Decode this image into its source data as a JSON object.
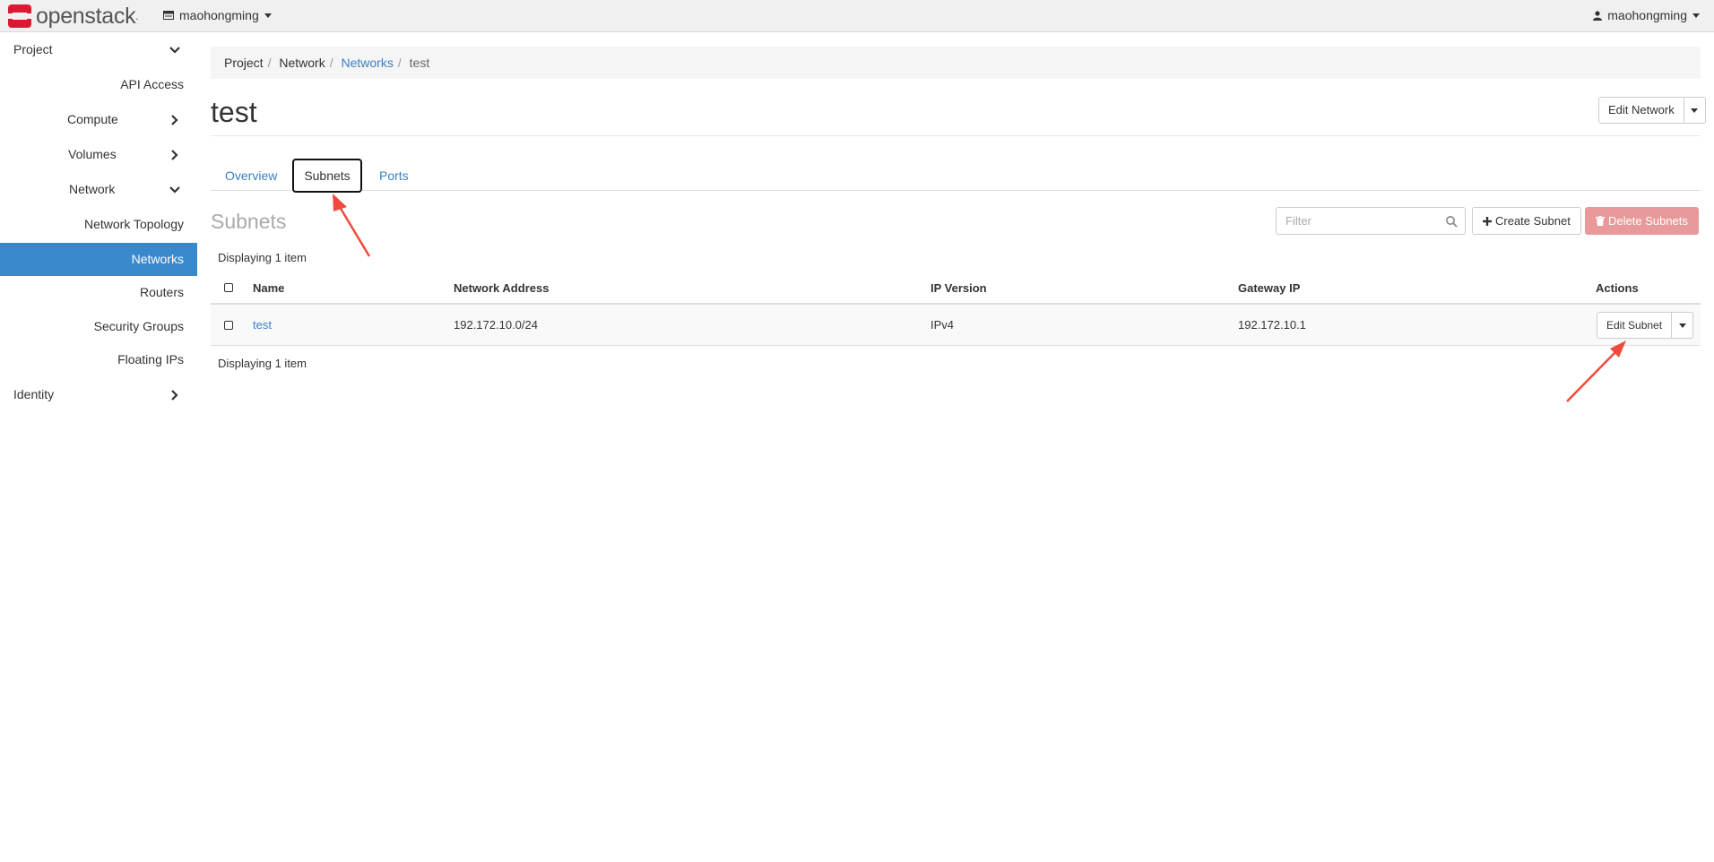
{
  "navbar": {
    "brand": "openstack",
    "brand_suffix": ".",
    "project": "maohongming",
    "user": "maohongming"
  },
  "sidebar": {
    "items": [
      {
        "label": "Project",
        "chevron": "down"
      },
      {
        "label": "API Access"
      },
      {
        "label": "Compute",
        "chevron": "right"
      },
      {
        "label": "Volumes",
        "chevron": "right"
      },
      {
        "label": "Network",
        "chevron": "down"
      },
      {
        "label": "Network Topology"
      },
      {
        "label": "Networks",
        "active": true
      },
      {
        "label": "Routers"
      },
      {
        "label": "Security Groups"
      },
      {
        "label": "Floating IPs"
      },
      {
        "label": "Identity",
        "chevron": "right"
      }
    ]
  },
  "breadcrumb": {
    "items": [
      "Project",
      "Network",
      "Networks",
      "test"
    ]
  },
  "page": {
    "title": "test",
    "edit_network": "Edit Network"
  },
  "tabs": [
    "Overview",
    "Subnets",
    "Ports"
  ],
  "subnets": {
    "title": "Subnets",
    "filter_placeholder": "Filter",
    "create_label": "Create Subnet",
    "delete_label": "Delete Subnets",
    "count_top": "Displaying 1 item",
    "count_bottom": "Displaying 1 item",
    "columns": [
      "Name",
      "Network Address",
      "IP Version",
      "Gateway IP",
      "Actions"
    ],
    "rows": [
      {
        "name": "test",
        "network_address": "192.172.10.0/24",
        "ip_version": "IPv4",
        "gateway_ip": "192.172.10.1",
        "action": "Edit Subnet"
      }
    ]
  },
  "colors": {
    "accent": "#3a88cc",
    "link": "#3a7fc3",
    "danger": "#e89a9a",
    "annotation": "#f04a3e",
    "brand_red": "#da1a32"
  }
}
